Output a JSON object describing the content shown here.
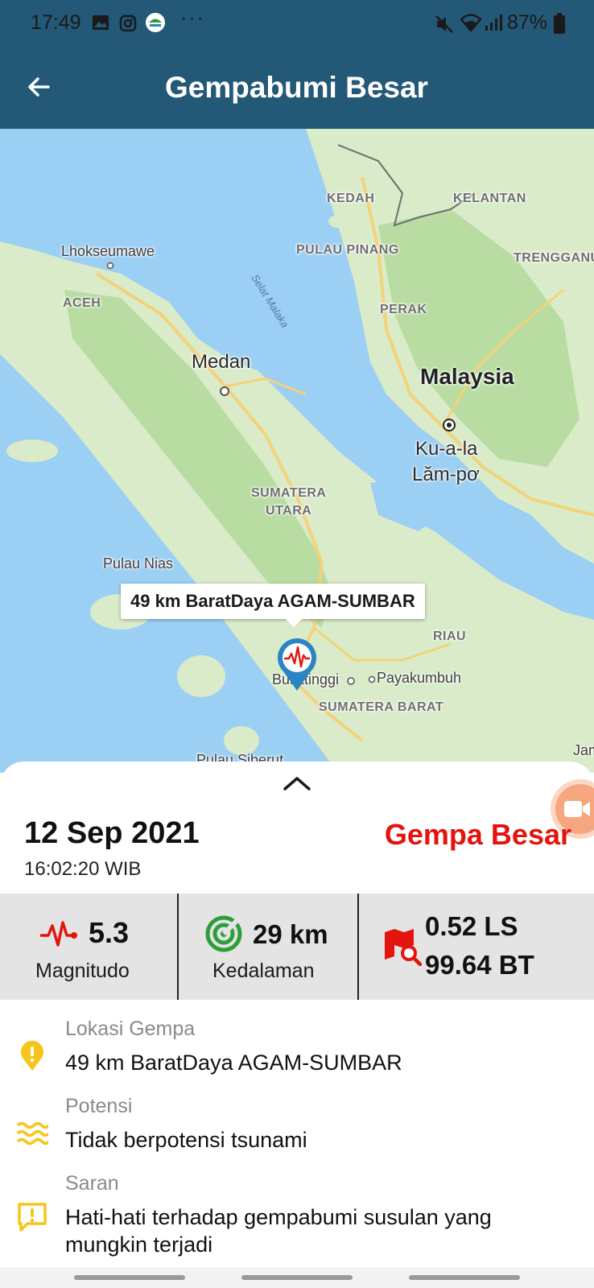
{
  "status_bar": {
    "time": "17:49",
    "battery": "87%",
    "overflow": "···",
    "icons": [
      "gallery-icon",
      "instagram-icon",
      "bmkg-app-icon",
      "mute-icon",
      "wifi-icon",
      "signal-icon",
      "battery-icon"
    ]
  },
  "header": {
    "title": "Gempabumi Besar",
    "back_icon": "arrow-left-icon"
  },
  "map": {
    "info_window": "49 km BaratDaya AGAM-SUMBAR",
    "labels": {
      "kedah": "KEDAH",
      "kelantan": "KELANTAN",
      "lhokseumawe": "Lhokseumawe",
      "pulau_pinang": "PULAU PINANG",
      "terengganu": "TRENGGANU",
      "selat_malaka": "Selat Malaka",
      "aceh": "ACEH",
      "perak": "PERAK",
      "medan": "Medan",
      "malaysia": "Malaysia",
      "kuala_lumpur_1": "Ku-a-la",
      "kuala_lumpur_2": "Lăm-pơ",
      "sumatera_utara_1": "SUMATERA",
      "sumatera_utara_2": "UTARA",
      "pulau_nias": "Pulau Nias",
      "riau": "RIAU",
      "bukittinggi": "Bukittinggi",
      "payakumbuh": "Payakumbuh",
      "sumatera_barat": "SUMATERA BARAT",
      "pulau_siberut": "Pulau Siberut",
      "jambi_partial": "Jam"
    },
    "colors": {
      "sea": "#9ccff4",
      "land": "#d9ebc8",
      "forest": "#b8dca1",
      "road": "#f3d27a"
    }
  },
  "event": {
    "date": "12 Sep 2021",
    "time": "16:02:20 WIB",
    "category": "Gempa Besar",
    "category_color": "#e3140e",
    "magnitude": "5.3",
    "magnitude_label": "Magnitudo",
    "depth": "29 km",
    "depth_label": "Kedalaman",
    "latitude": "0.52 LS",
    "longitude": "99.64 BT"
  },
  "details": [
    {
      "icon": "alert-pin-icon",
      "label": "Lokasi Gempa",
      "value": "49 km BaratDaya AGAM-SUMBAR"
    },
    {
      "icon": "waves-icon",
      "label": "Potensi",
      "value": "Tidak berpotensi tsunami"
    },
    {
      "icon": "message-alert-icon",
      "label": "Saran",
      "value": "Hati-hati terhadap gempabumi susulan yang mungkin terjadi"
    }
  ],
  "accent_colors": {
    "header": "#235877",
    "marker": "#2a85c2",
    "icon_red": "#e3140e",
    "icon_green": "#2e9e3a",
    "icon_yellow": "#f5c518"
  }
}
